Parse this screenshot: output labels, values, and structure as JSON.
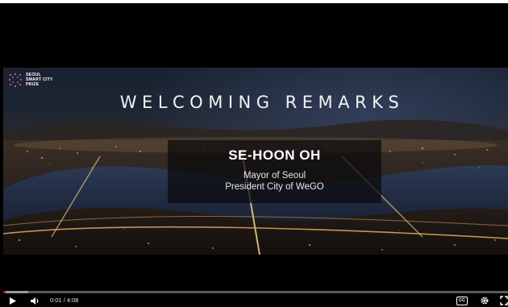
{
  "overlay": {
    "brand_lines": [
      "SEOUL",
      "SMART CITY",
      "PRIZE"
    ],
    "headline": "WELCOMING REMARKS",
    "speaker_name": "SE-HOON OH",
    "speaker_titles": [
      "Mayor of Seoul",
      "President City of WeGO"
    ]
  },
  "controls": {
    "current_time": "0:01",
    "separator": " / ",
    "duration": "4:08",
    "progress_fraction": 0.004,
    "buffered_fraction": 0.05,
    "icons": [
      "play-icon",
      "volume-icon",
      "captions-icon",
      "settings-icon",
      "fullscreen-icon"
    ],
    "captions_label": "CC"
  },
  "colors": {
    "progress": "#ff0000",
    "track": "#5a5a5a",
    "player_bg": "#000000"
  }
}
